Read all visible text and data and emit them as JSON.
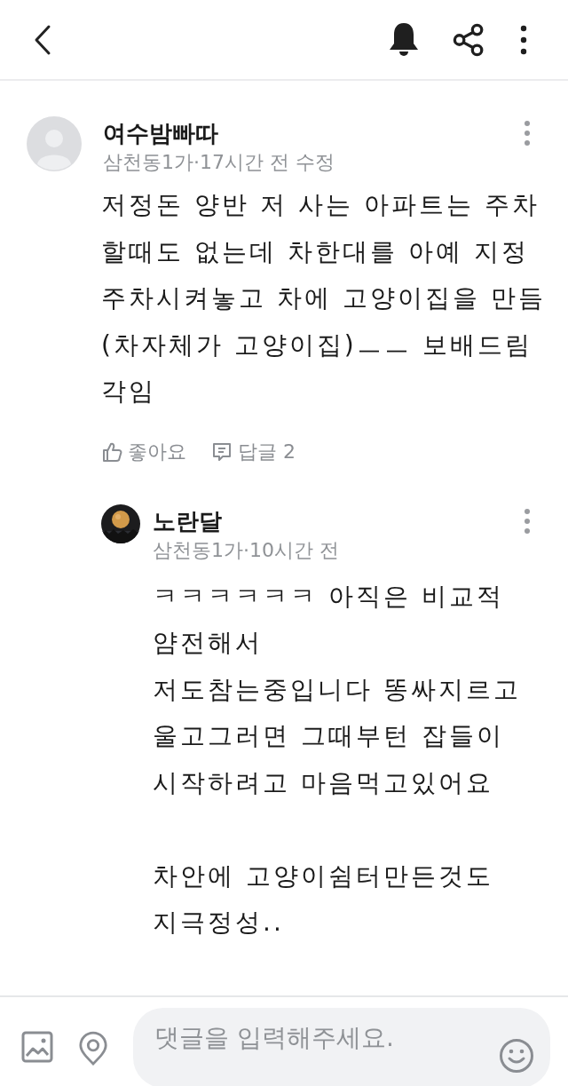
{
  "comments": [
    {
      "author": "여수밤빠따",
      "meta": "삼천동1가·17시간 전 수정",
      "avatar": {
        "kind": "default"
      },
      "text": "저정돈 양반 저 사는 아파트는 주차할때도 없는데 차한대를 아예 지정주차시켜놓고 차에 고양이집을 만듬 (차자체가 고양이집)ㅡㅡ 보배드림각임",
      "actions": {
        "like": "좋아요",
        "reply": "답글 2"
      },
      "replies": [
        {
          "author": "노란달",
          "meta": "삼천동1가·10시간 전",
          "text": "ㅋㅋㅋㅋㅋㅋ 아직은 비교적 얌전해서\n저도참는중입니다 똥싸지르고 울고그러면 그때부턴 잡들이시작하려고 마음먹고있어요\n\n차안에 고양이쉼터만든것도 지극정성.."
        }
      ]
    }
  ],
  "composer": {
    "placeholder": "댓글을 입력해주세요."
  }
}
